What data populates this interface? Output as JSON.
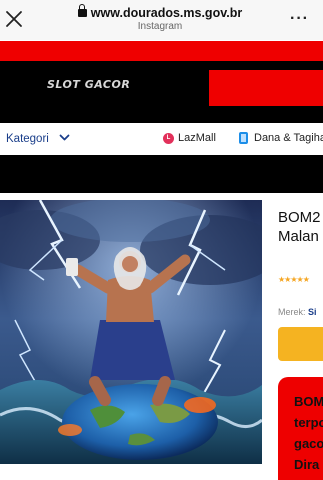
{
  "browser": {
    "url": "www.dourados.ms.gov.br",
    "source": "Instagram",
    "more_label": "···"
  },
  "header": {
    "logo_text": "SLOT GACOR"
  },
  "nav": {
    "category_label": "Kategori",
    "items": [
      {
        "label": "LazMall",
        "icon": "lazmall-icon"
      },
      {
        "label": "Dana & Tagiha",
        "icon": "dana-icon"
      }
    ]
  },
  "product": {
    "title_lines": [
      "BOM2",
      "Malan"
    ],
    "rating_stars": 5,
    "stars_text": "★★★★★",
    "brand_label": "Merek: ",
    "brand_value": "Si",
    "promo_lines": [
      "BOM",
      "terpo",
      "gaco",
      "Dira"
    ]
  },
  "colors": {
    "red": "#ef0000",
    "black": "#000000",
    "yellow": "#f5b321",
    "link_blue": "#1a3e8a"
  }
}
